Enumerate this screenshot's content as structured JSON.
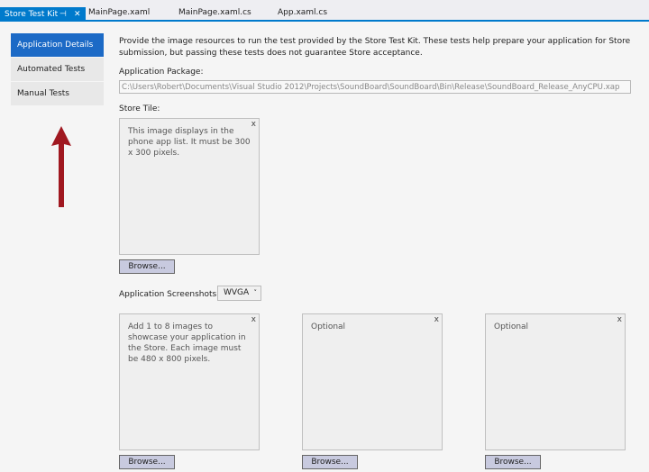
{
  "tabs": [
    {
      "label": "Store Test Kit",
      "active": true
    },
    {
      "label": "MainPage.xaml"
    },
    {
      "label": "MainPage.xaml.cs"
    },
    {
      "label": "App.xaml.cs"
    }
  ],
  "tab_icons": {
    "pin": "⊣",
    "close": "✕"
  },
  "nav": {
    "items": [
      {
        "label": "Application Details",
        "selected": true
      },
      {
        "label": "Automated Tests"
      },
      {
        "label": "Manual Tests"
      }
    ]
  },
  "main": {
    "description": "Provide the image resources to run the test provided by the Store Test Kit. These tests help prepare your application for Store submission, but passing these tests does not guarantee Store acceptance.",
    "package_label": "Application Package:",
    "package_value": "C:\\Users\\Robert\\Documents\\Visual Studio 2012\\Projects\\SoundBoard\\SoundBoard\\Bin\\Release\\SoundBoard_Release_AnyCPU.xap",
    "store_tile_label": "Store Tile:",
    "store_tile_hint": "This image displays in the phone app list. It must be 300 x 300 pixels.",
    "browse_label": "Browse...",
    "screenshots_label": "Application Screenshots:",
    "resolution": "WVGA",
    "screenshot_hints": [
      "Add 1 to 8 images to showcase your application in the Store. Each image must be 480 x 800 pixels.",
      "Optional",
      "Optional"
    ],
    "close_glyph": "x"
  },
  "colors": {
    "accent": "#007acc",
    "selected": "#1c6ac6",
    "arrow": "#a01820"
  }
}
